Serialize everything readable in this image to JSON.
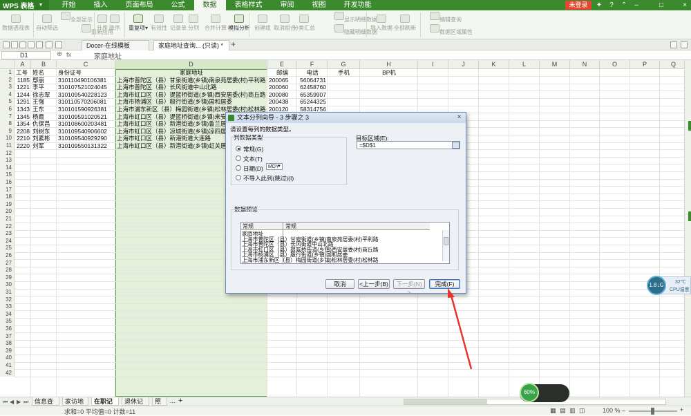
{
  "app": {
    "name": "WPS 表格",
    "login": "未登录"
  },
  "menu": [
    "开始",
    "插入",
    "页面布局",
    "公式",
    "数据",
    "表格样式",
    "审阅",
    "视图",
    "开发功能"
  ],
  "menu_active_index": 4,
  "ribbon": {
    "items": [
      {
        "label": "数据透视表",
        "enabled": false
      },
      {
        "label": "自动筛选",
        "enabled": false
      },
      {
        "label": "全部显示",
        "enabled": false
      },
      {
        "label": "重新应用",
        "enabled": false
      },
      {
        "label": "升序",
        "enabled": false
      },
      {
        "label": "降序",
        "enabled": false
      },
      {
        "label": "重复项▾",
        "enabled": true
      },
      {
        "label": "有效性",
        "enabled": false
      },
      {
        "label": "记录单",
        "enabled": false
      },
      {
        "label": "分列",
        "enabled": false
      },
      {
        "label": "合并计算",
        "enabled": false
      },
      {
        "label": "模拟分析",
        "enabled": true
      },
      {
        "label": "创建组",
        "enabled": false
      },
      {
        "label": "取消组合",
        "enabled": false
      },
      {
        "label": "分类汇总",
        "enabled": false
      },
      {
        "label": "显示明细数据",
        "enabled": false
      },
      {
        "label": "隐藏明细数据",
        "enabled": false
      },
      {
        "label": "导入数据",
        "enabled": false
      },
      {
        "label": "全部刷新",
        "enabled": false
      },
      {
        "label": "编辑查询",
        "enabled": false
      },
      {
        "label": "数据区域属性",
        "enabled": false
      }
    ]
  },
  "doc_tabs": [
    {
      "label": "Docer-在线模板",
      "active": false
    },
    {
      "label": "家庭地址查询... (只读) *",
      "active": true
    }
  ],
  "formula_bar": {
    "cell": "D1",
    "fx": "fx",
    "content": "家庭地址"
  },
  "columns": [
    "A",
    "B",
    "C",
    "D",
    "E",
    "F",
    "G",
    "H",
    "I",
    "J",
    "K",
    "L",
    "M",
    "N",
    "O",
    "P",
    "Q"
  ],
  "row_count": 42,
  "headers": {
    "A": "工号",
    "B": "姓名",
    "C": "身份证号",
    "D": "家庭地址",
    "E": "邮编",
    "F": "电话",
    "G": "手机",
    "H": "BP机"
  },
  "rows": [
    {
      "id": "1185",
      "name": "鄢丽",
      "idno": "310110490106381",
      "addr": "上海市普陀区（县）甘泉街道(乡镇)南泉苑居委(村)平利路",
      "zip": "200065",
      "tel": "56064731"
    },
    {
      "id": "1221",
      "name": "李平",
      "idno": "310107521024045",
      "addr": "上海市普陀区（县）长风街道中山北路",
      "zip": "200060",
      "tel": "62458760"
    },
    {
      "id": "1244",
      "name": "徐志翠",
      "idno": "310109540228123",
      "addr": "上海市虹口区（县）提篮桥街道(乡镇)西安居委(村)商丘路",
      "zip": "200080",
      "tel": "65359907"
    },
    {
      "id": "1291",
      "name": "王强",
      "idno": "310110570206081",
      "addr": "上海市杨浦区（县）殷行街道(乡镇)国和居委",
      "zip": "200438",
      "tel": "65244325"
    },
    {
      "id": "1343",
      "name": "王东",
      "idno": "310101590926381",
      "addr": "上海市浦东新区（县）梅园街道(乡镇)松林居委(村)松林路",
      "zip": "200120",
      "tel": "58314756"
    },
    {
      "id": "1345",
      "name": "杨霞",
      "idno": "310109591020521",
      "addr": "上海市虹口区（县）提篮桥街道(乡镇)来安居委",
      "zip": "",
      "tel": ""
    },
    {
      "id": "1354",
      "name": "仇保昌",
      "idno": "310108600203481",
      "addr": "上海市虹口区（县）新港街道(乡镇)鲁兰居委",
      "zip": "",
      "tel": ""
    },
    {
      "id": "2208",
      "name": "刘树东",
      "idno": "310109540906602",
      "addr": "上海市虹口区（县）凉城街道(乡镇)凉四居委",
      "zip": "",
      "tel": ""
    },
    {
      "id": "2210",
      "name": "刘素彬",
      "idno": "310109540929290",
      "addr": "上海市虹口区（县）新港街道大连路",
      "zip": "",
      "tel": ""
    },
    {
      "id": "2220",
      "name": "刘军",
      "idno": "310109550131322",
      "addr": "上海市虹口区（县）新港街道(乡镇)虹关居委",
      "zip": "",
      "tel": ""
    }
  ],
  "dialog": {
    "title": "文本分列向导 - 3 步骤之 3",
    "prompt": "请设置每列的数据类型。",
    "col_type_label": "列数据类型",
    "options": [
      {
        "label": "常规(G)",
        "checked": true
      },
      {
        "label": "文本(T)",
        "checked": false
      },
      {
        "label": "日期(D)",
        "checked": false
      },
      {
        "label": "不导入此列(跳过)(I)",
        "checked": false
      }
    ],
    "date_format": "MDY",
    "target_label": "目标区域(E):",
    "target_value": "=$D$1",
    "preview_label": "数据预览",
    "preview_headers": [
      "常规",
      "常规"
    ],
    "preview_lines": [
      "家庭地址",
      "上海市普陀区（县）甘泉街道(乡镇)南泉苑居委(村)平利路",
      "上海市普陀区（县）长风街道中山北路",
      "上海市虹口区（县）提篮桥街道(乡镇)西安居委(村)商丘路",
      "上海市杨浦区（县）殷行街道(乡镇)国和居委",
      "上海市浦东新区（县）梅园街道(乡镇)松林居委(村)松林路"
    ],
    "buttons": {
      "cancel": "取消",
      "back": "<上一步(B)",
      "next": "下一步(N) >",
      "finish": "完成(F)"
    }
  },
  "sheet_tabs": [
    {
      "label": "信息查询",
      "active": false
    },
    {
      "label": "家访地址",
      "active": false
    },
    {
      "label": "在职记录",
      "active": true
    },
    {
      "label": "退休记录",
      "active": false
    },
    {
      "label": "照片",
      "active": false
    }
  ],
  "sheet_more": "...",
  "status": {
    "summary": "求和=0  平均值=0  计数=11",
    "zoom": "100 %"
  },
  "cpu": {
    "value": "1.8↓G",
    "temp": "32℃",
    "label": "CPU温度"
  },
  "speed": {
    "value": "60%"
  },
  "colors": {
    "menubar": "#3c8a2e",
    "selection": "#cde4ba",
    "annotation_arrow": "#e8332a"
  }
}
